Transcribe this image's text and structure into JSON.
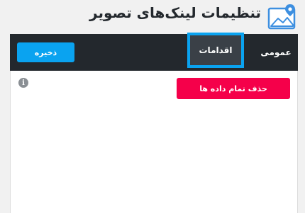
{
  "header": {
    "title": "تنظیمات لینک‌های تصویر",
    "logo_icon": "image-location-icon"
  },
  "tabs": [
    {
      "label": "عمومی",
      "active": false
    },
    {
      "label": "اقدامات",
      "active": true
    }
  ],
  "toolbar": {
    "save_label": "ذخیره"
  },
  "actions": {
    "delete_all_label": "حذف تمام داده ها",
    "info_icon": "info-icon"
  },
  "colors": {
    "accent": "#0aa3f0",
    "danger": "#f5004a",
    "navbar": "#23282d"
  }
}
